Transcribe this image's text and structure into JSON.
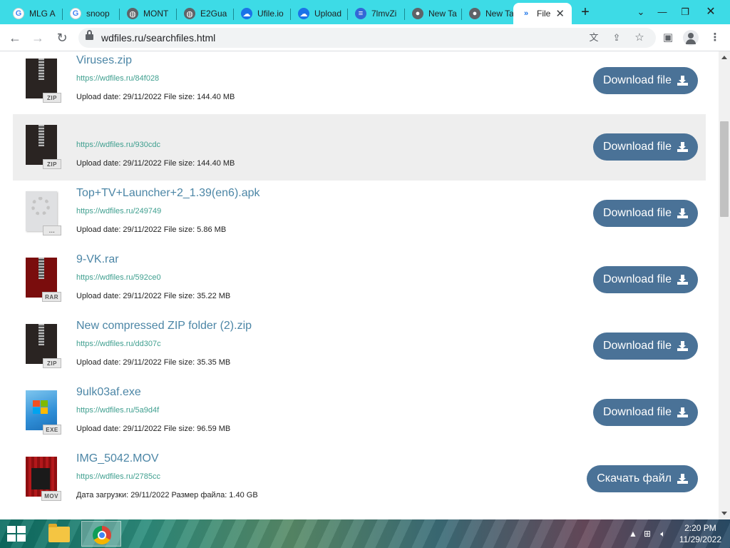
{
  "browser": {
    "tabs": [
      {
        "label": "MLG A",
        "favicon": "google-g-icon"
      },
      {
        "label": "snoop",
        "favicon": "google-g-icon"
      },
      {
        "label": "MONT",
        "favicon": "globe-icon"
      },
      {
        "label": "E2Gua",
        "favicon": "globe-icon"
      },
      {
        "label": "Ufile.io",
        "favicon": "cloud-icon"
      },
      {
        "label": "Upload",
        "favicon": "cloud-icon"
      },
      {
        "label": "7lmvZi",
        "favicon": "document-icon"
      },
      {
        "label": "New Ta",
        "favicon": "chrome-icon"
      },
      {
        "label": "New Ta",
        "favicon": "chrome-icon"
      },
      {
        "label": "File",
        "favicon": "double-chevron-icon"
      }
    ],
    "url": "wdfiles.ru/searchfiles.html"
  },
  "files": [
    {
      "name": "Viruses.zip",
      "link": "https://wdfiles.ru/84f028",
      "info": "Upload date: 29/11/2022 File size: 144.40 MB",
      "button": "Download file",
      "type": "zip"
    },
    {
      "name": "",
      "link": "https://wdfiles.ru/930cdc",
      "info": "Upload date: 29/11/2022 File size: 144.40 MB",
      "button": "Download file",
      "type": "zip"
    },
    {
      "name": "Top+TV+Launcher+2_1.39(en6).apk",
      "link": "https://wdfiles.ru/249749",
      "info": "Upload date: 29/11/2022 File size: 5.86 MB",
      "button": "Download file",
      "type": "generic"
    },
    {
      "name": "9-VK.rar",
      "link": "https://wdfiles.ru/592ce0",
      "info": "Upload date: 29/11/2022 File size: 35.22 MB",
      "button": "Download file",
      "type": "rar"
    },
    {
      "name": "New compressed ZIP folder (2).zip",
      "link": "https://wdfiles.ru/dd307c",
      "info": "Upload date: 29/11/2022 File size: 35.35 MB",
      "button": "Download file",
      "type": "zip"
    },
    {
      "name": "9ulk03af.exe",
      "link": "https://wdfiles.ru/5a9d4f",
      "info": "Upload date: 29/11/2022 File size: 96.59 MB",
      "button": "Download file",
      "type": "exe"
    },
    {
      "name": "IMG_5042.MOV",
      "link": "https://wdfiles.ru/2785cc",
      "info": "Дата загрузки: 29/11/2022  Размер файла: 1.40 GB",
      "button": "Скачать файл",
      "type": "mov"
    }
  ],
  "thumb_tags": {
    "zip": "ZIP",
    "rar": "RAR",
    "exe": "EXE",
    "mov": "MOV",
    "generic": "..."
  },
  "taskbar": {
    "time": "2:20 PM",
    "date": "11/29/2022"
  },
  "colors": {
    "tabstrip": "#3ddbe6",
    "link": "#4c86a6",
    "button": "#4a7297",
    "url_green": "#3f9f8f"
  }
}
